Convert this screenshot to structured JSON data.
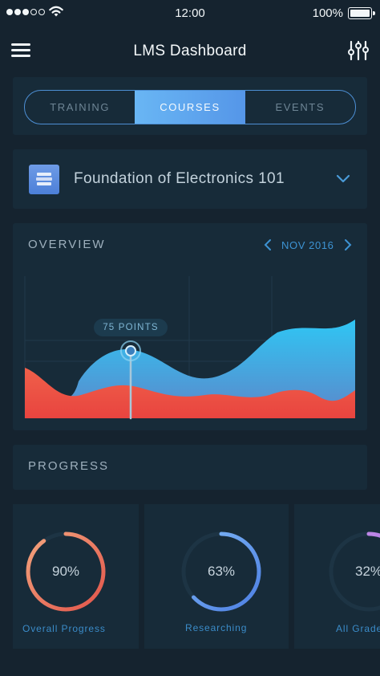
{
  "status_bar": {
    "time": "12:00",
    "battery": "100%"
  },
  "nav": {
    "title": "LMS Dashboard"
  },
  "tabs": [
    {
      "label": "TRAINING",
      "active": false
    },
    {
      "label": "COURSES",
      "active": true
    },
    {
      "label": "EVENTS",
      "active": false
    }
  ],
  "course": {
    "name": "Foundation of Electronics 101"
  },
  "overview": {
    "title": "OVERVIEW",
    "date": "NOV 2016",
    "tooltip": "75 POINTS"
  },
  "progress": {
    "title": "PROGRESS",
    "items": [
      {
        "label": "Overall Progress",
        "value": "90%",
        "fraction": 0.9,
        "colors": [
          "#f2a57e",
          "#e2544a"
        ]
      },
      {
        "label": "Researching",
        "value": "63%",
        "fraction": 0.63,
        "colors": [
          "#7fb8f6",
          "#4d7fe3"
        ]
      },
      {
        "label": "All Grades",
        "value": "32%",
        "fraction": 0.32,
        "colors": [
          "#c98ee8",
          "#9b6fe0"
        ]
      }
    ]
  },
  "colors": {
    "accent": "#5596e8",
    "chart_blue": "#2ec3f2",
    "chart_red": "#ee5a48",
    "background": "#15232f"
  }
}
